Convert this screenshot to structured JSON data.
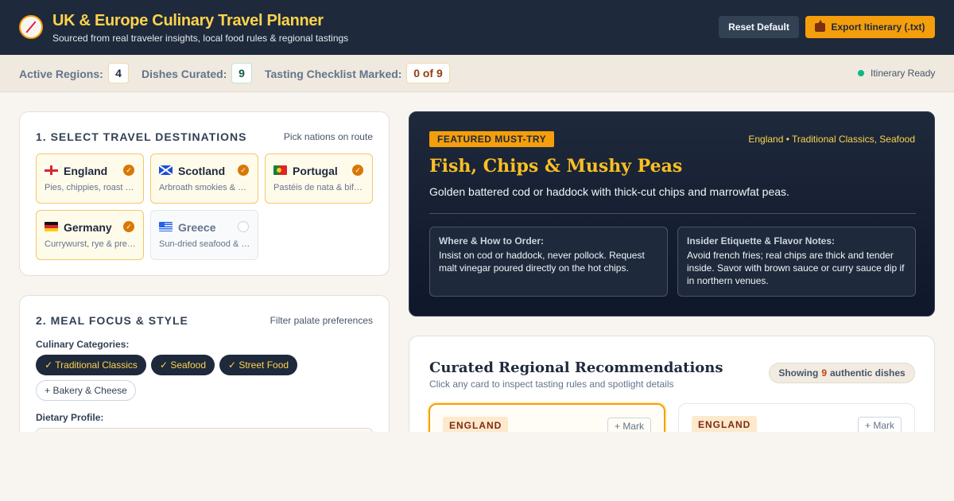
{
  "header": {
    "title": "UK & Europe Culinary Travel Planner",
    "subtitle": "Sourced from real traveler insights, local food rules & regional tastings",
    "reset_label": "Reset Default",
    "export_label": "Export Itinerary (.txt)",
    "logo_icon": "compass-icon",
    "export_icon": "inbox-tray-icon"
  },
  "stats": {
    "regions_label": "Active Regions:",
    "regions_value": "4",
    "dishes_label": "Dishes Curated:",
    "dishes_value": "9",
    "checklist_label": "Tasting Checklist Marked:",
    "checklist_value": "0 of 9",
    "status_text": "Itinerary Ready"
  },
  "destinations": {
    "heading": "1. SELECT TRAVEL DESTINATIONS",
    "hint": "Pick nations on route",
    "items": [
      {
        "name": "England",
        "desc": "Pies, chippies, roast dinners",
        "selected": true,
        "flag": "england-flag-icon"
      },
      {
        "name": "Scotland",
        "desc": "Arbroath smokies & haggis",
        "selected": true,
        "flag": "scotland-flag-icon"
      },
      {
        "name": "Portugal",
        "desc": "Pastéis de nata & bifanas",
        "selected": true,
        "flag": "portugal-flag-icon"
      },
      {
        "name": "Germany",
        "desc": "Currywurst, rye & pretzels",
        "selected": true,
        "flag": "germany-flag-icon"
      },
      {
        "name": "Greece",
        "desc": "Sun-dried seafood & feta",
        "selected": false,
        "flag": "greece-flag-icon"
      }
    ]
  },
  "meal_focus": {
    "heading": "2. MEAL FOCUS & STYLE",
    "hint": "Filter palate preferences",
    "categories_label": "Culinary Categories:",
    "categories": [
      {
        "label": "✓ Traditional Classics",
        "selected": true
      },
      {
        "label": "✓ Seafood",
        "selected": true
      },
      {
        "label": "✓ Street Food",
        "selected": true
      },
      {
        "label": "+ Bakery & Cheese",
        "selected": false
      }
    ],
    "dietary_label": "Dietary Profile:"
  },
  "featured": {
    "badge": "FEATURED MUST-TRY",
    "meta": "England • Traditional Classics, Seafood",
    "title": "Fish, Chips & Mushy Peas",
    "description": "Golden battered cod or haddock with thick-cut chips and marrowfat peas.",
    "where_heading": "Where & How to Order:",
    "where_text": "Insist on cod or haddock, never pollock. Request malt vinegar poured directly on the hot chips.",
    "etiquette_heading": "Insider Etiquette & Flavor Notes:",
    "etiquette_text": "Avoid french fries; real chips are thick and tender inside. Savor with brown sauce or curry sauce dip if in northern venues."
  },
  "recommendations": {
    "title": "Curated Regional Recommendations",
    "subtitle": "Click any card to inspect tasting rules and spotlight details",
    "count_prefix": "Showing",
    "count_value": "9",
    "count_suffix": "authentic dishes",
    "cards": [
      {
        "region": "ENGLAND",
        "mark_label": "+ Mark",
        "selected": true
      },
      {
        "region": "ENGLAND",
        "mark_label": "+ Mark",
        "selected": false
      }
    ]
  },
  "colors": {
    "header_bg": "#1e293b",
    "accent": "#f59e0b",
    "title_yellow": "#fcd34d",
    "ready_green": "#10b981"
  }
}
